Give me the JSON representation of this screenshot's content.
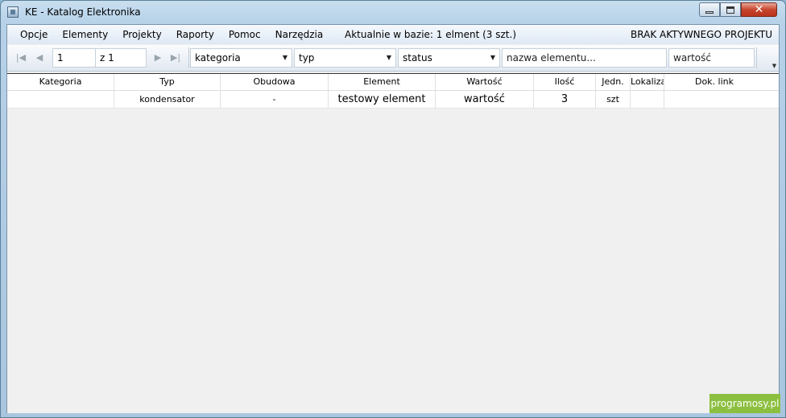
{
  "window": {
    "title": "KE - Katalog Elektronika"
  },
  "menu": {
    "items": [
      "Opcje",
      "Elementy",
      "Projekty",
      "Raporty",
      "Pomoc",
      "Narzędzia"
    ],
    "status": "Aktualnie w bazie: 1 elment (3 szt.)",
    "project": "BRAK AKTYWNEGO PROJEKTU"
  },
  "toolbar": {
    "page_value": "1",
    "page_of": "z 1",
    "category": "kategoria",
    "type": "typ",
    "status": "status",
    "name_placeholder": "nazwa elementu...",
    "value_placeholder": "wartość"
  },
  "table": {
    "columns": [
      "Kategoria",
      "Typ",
      "Obudowa",
      "Element",
      "Wartość",
      "Ilość",
      "Jedn.",
      "Lokalizacja",
      "Dok. link"
    ],
    "rows": [
      [
        "",
        "kondensator",
        "-",
        "testowy element",
        "wartość",
        "3",
        "szt",
        "",
        ""
      ]
    ]
  },
  "watermark": "programosy.pl"
}
